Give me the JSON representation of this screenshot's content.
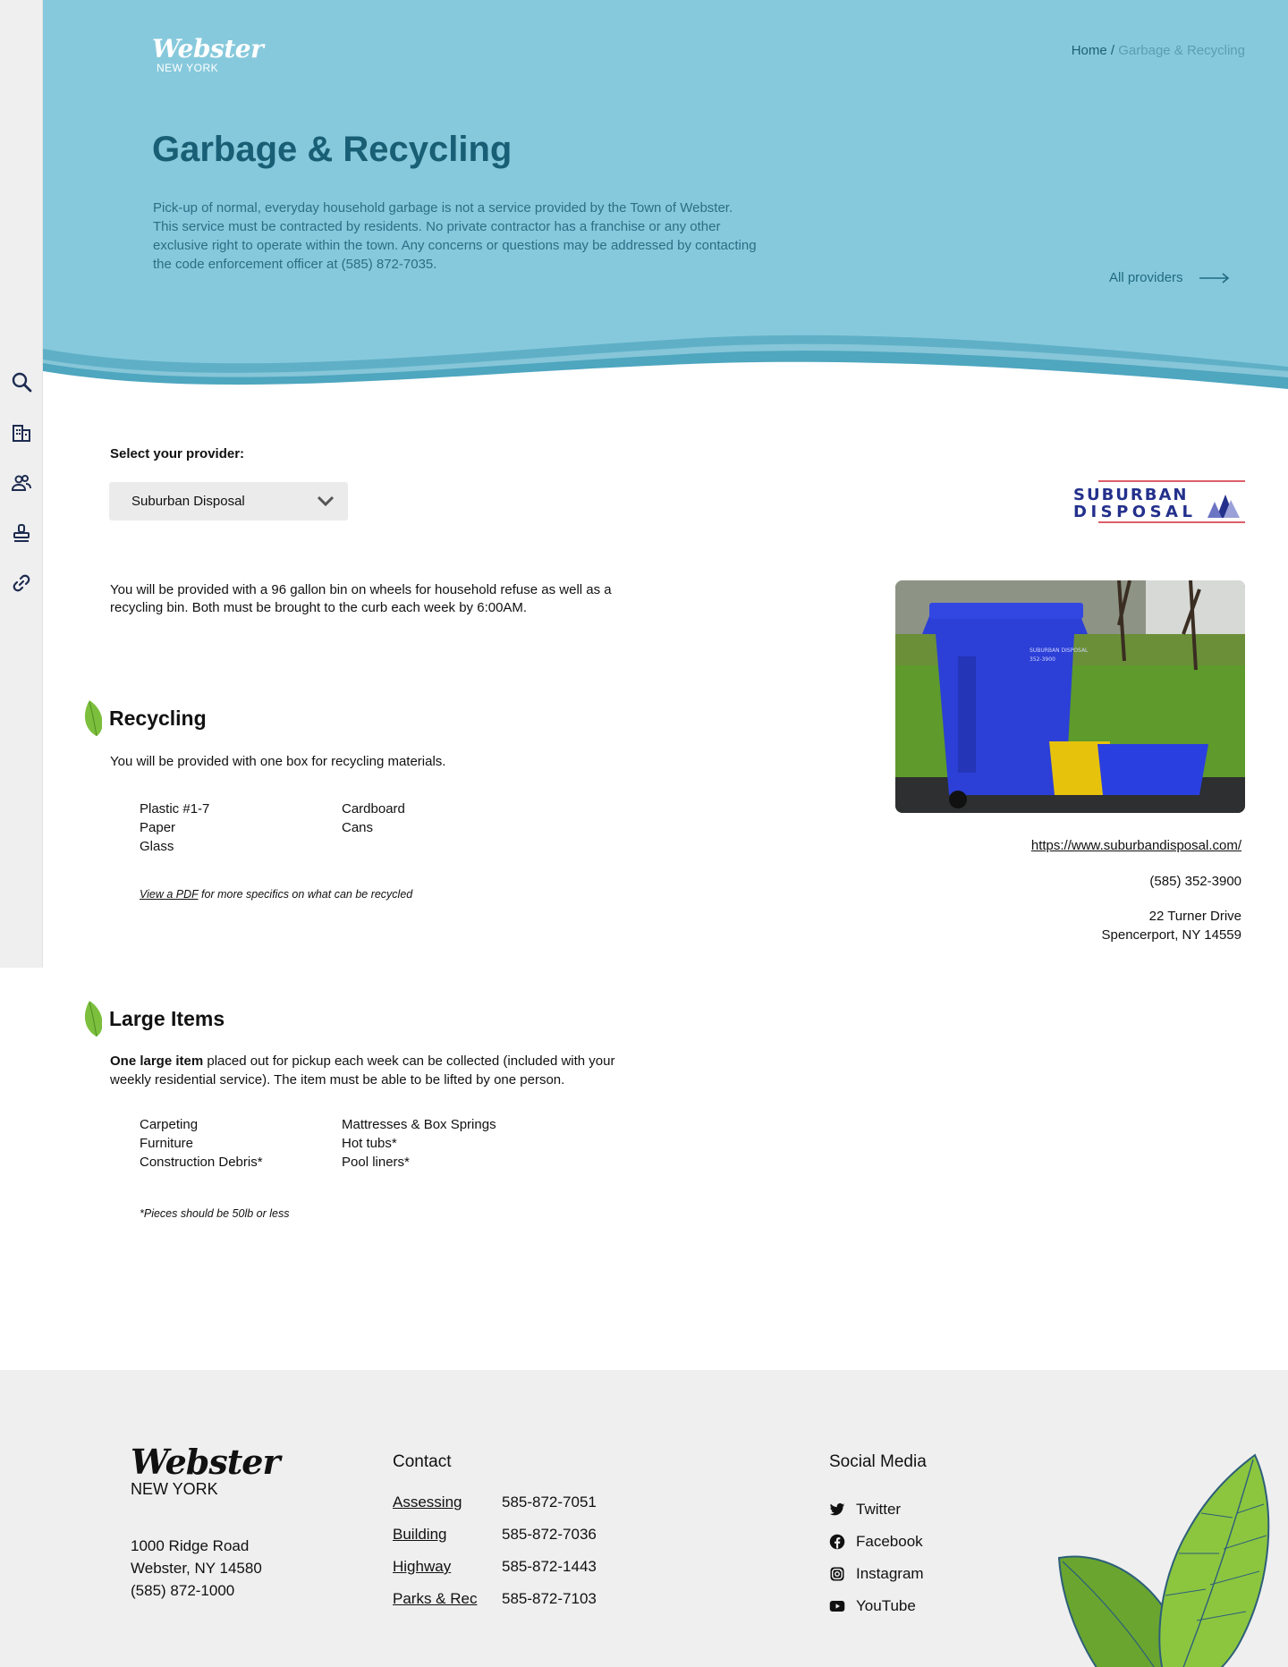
{
  "site": {
    "logo_script": "Webster",
    "logo_sub": "NEW YORK"
  },
  "breadcrumb": {
    "home": "Home",
    "separator": " / ",
    "current": "Garbage & Recycling"
  },
  "hero": {
    "title": "Garbage & Recycling",
    "intro": "Pick-up of normal, everyday household garbage is not a service provided by the Town of Webster. This service must be contracted by residents. No private contractor has a franchise or any other exclusive right to operate within the town. Any concerns or questions may be addressed by contacting the code enforcement officer at (585) 872-7035.",
    "all_providers": "All providers"
  },
  "rail": {
    "icons": [
      "search-icon",
      "building-icon",
      "people-icon",
      "stamp-icon",
      "link-icon"
    ]
  },
  "provider": {
    "label": "Select your provider:",
    "selected": "Suburban Disposal",
    "logo_line1": "SUBURBAN",
    "logo_line2": "DISPOSAL",
    "description": "You will be provided with a 96 gallon bin on wheels for household refuse as well as a recycling bin. Both must be brought to the curb each week by 6:00AM.",
    "website": "https://www.suburbandisposal.com/",
    "phone": "(585) 352-3900",
    "address_line1": "22 Turner Drive",
    "address_line2": "Spencerport, NY 14559",
    "photo_bin_text": "SUBURBAN DISPOSAL",
    "photo_bin_phone": "352-3900"
  },
  "recycling": {
    "title": "Recycling",
    "text": "You will be provided with one box for recycling materials.",
    "items": [
      "Plastic #1-7",
      "Cardboard",
      "Paper",
      "Cans",
      "Glass",
      ""
    ],
    "pdf_link": "View a PDF",
    "pdf_rest": " for more specifics on what can be recycled"
  },
  "large_items": {
    "title": "Large Items",
    "text_bold": "One large item",
    "text_rest": " placed out for pickup each week can be collected (included with your weekly residential service). The item must be able to be lifted by one person.",
    "items": [
      "Carpeting",
      "Mattresses & Box Springs",
      "Furniture",
      "Hot tubs*",
      "Construction Debris*",
      "Pool liners*"
    ],
    "note": "*Pieces should be 50lb or less"
  },
  "footer": {
    "logo_script": "Webster",
    "logo_sub": "NEW YORK",
    "address_line1": "1000 Ridge Road",
    "address_line2": "Webster, NY 14580",
    "phone": "(585) 872-1000",
    "contact_heading": "Contact",
    "contacts": [
      {
        "name": "Assessing",
        "phone": "585-872-7051"
      },
      {
        "name": "Building",
        "phone": "585-872-7036"
      },
      {
        "name": "Highway",
        "phone": "585-872-1443"
      },
      {
        "name": "Parks & Rec",
        "phone": "585-872-7103"
      }
    ],
    "social_heading": "Social Media",
    "social": [
      "Twitter",
      "Facebook",
      "Instagram",
      "YouTube"
    ]
  },
  "colors": {
    "hero_bg": "#87c9dc",
    "hero_title": "#185e74",
    "wave": "#5fb0c7",
    "leaf": "#7cbf3d",
    "footer_bg": "#efefef"
  }
}
